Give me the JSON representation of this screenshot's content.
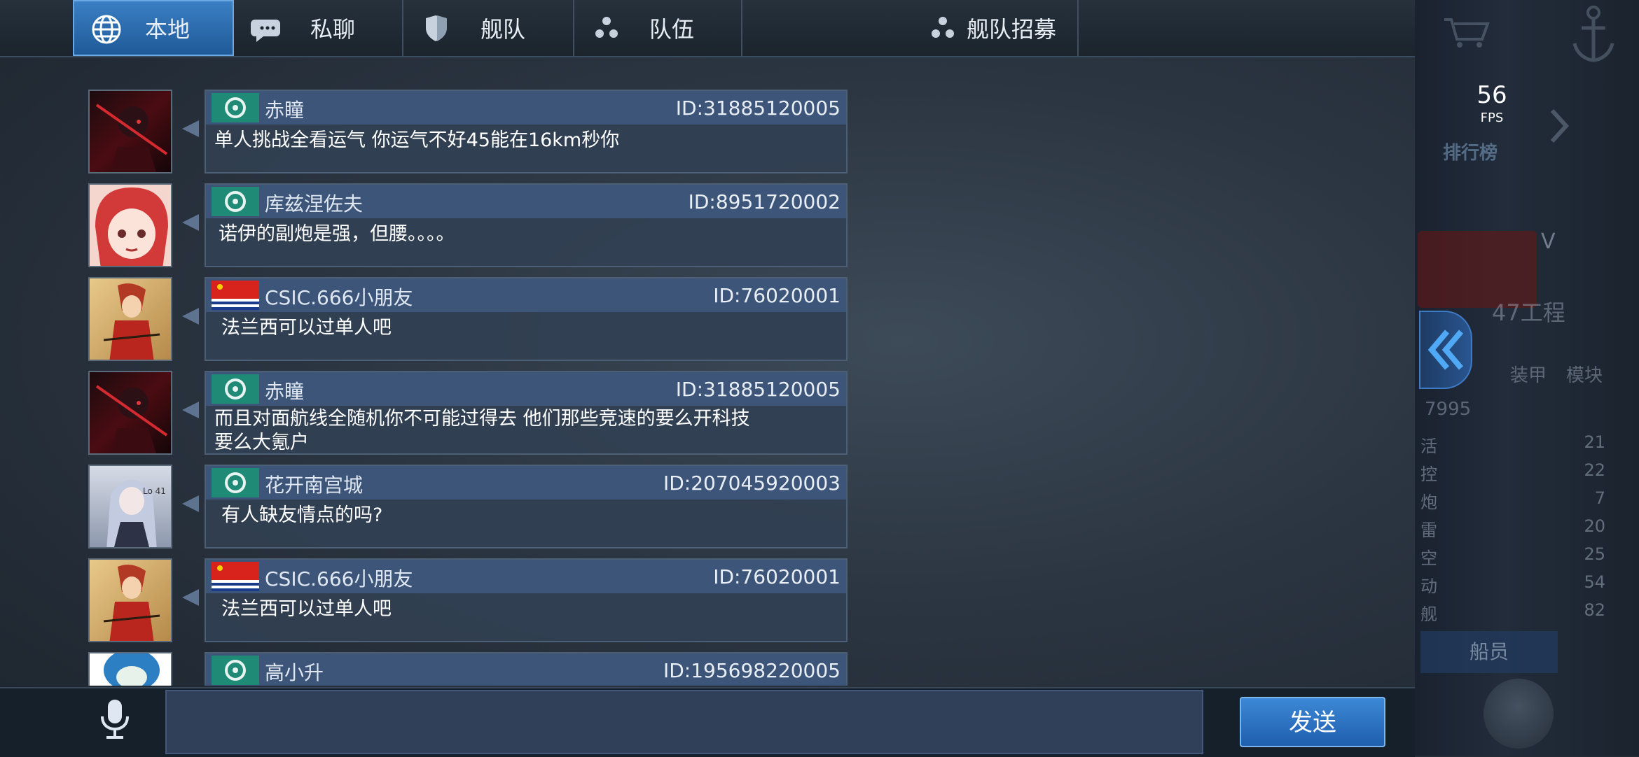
{
  "tabs": {
    "local": "本地",
    "private": "私聊",
    "fleet": "舰队",
    "team": "队伍",
    "recruit": "舰队招募"
  },
  "fps": {
    "value": "56",
    "label": "FPS"
  },
  "side_panel": {
    "rank_label": "排行榜",
    "grade": "V",
    "engineering": "47工程",
    "armor_label": "装甲",
    "module_label": "模块",
    "total": "7995",
    "stats": [
      {
        "key": "活",
        "value": "21"
      },
      {
        "key": "控",
        "value": "22"
      },
      {
        "key": "炮",
        "value": "7"
      },
      {
        "key": "雷",
        "value": "20"
      },
      {
        "key": "空",
        "value": "25"
      },
      {
        "key": "动",
        "value": "54"
      },
      {
        "key": "舰",
        "value": "82"
      }
    ],
    "crew_button": "船员"
  },
  "messages": [
    {
      "name": "赤瞳",
      "id": "ID:31885120005",
      "text": "单人挑战全看运气 你运气不好45能在16km秒你",
      "flag": "fleet"
    },
    {
      "name": "库兹涅佐夫",
      "id": "ID:8951720002",
      "text": "诺伊的副炮是强，但腰。。。。",
      "flag": "fleet"
    },
    {
      "name": "CSIC.666小朋友",
      "id": "ID:76020001",
      "text": "法兰西可以过单人吧",
      "flag": "china"
    },
    {
      "name": "赤瞳",
      "id": "ID:31885120005",
      "text": "而且对面航线全随机你不可能过得去 他们那些竞速的要么开科技\n  要么大氪户",
      "flag": "fleet"
    },
    {
      "name": "花开南宫城",
      "id": "ID:207045920003",
      "text": "有人缺友情点的吗?",
      "flag": "fleet"
    },
    {
      "name": "CSIC.666小朋友",
      "id": "ID:76020001",
      "text": "法兰西可以过单人吧",
      "flag": "china"
    },
    {
      "name": "高小升",
      "id": "ID:195698220005",
      "text": "",
      "flag": "fleet"
    }
  ],
  "input": {
    "placeholder": ""
  },
  "send_label": "发送",
  "colors": {
    "accent": "#2f73c0",
    "bubble_header": "#3d5579",
    "bubble_body": "#314052"
  }
}
